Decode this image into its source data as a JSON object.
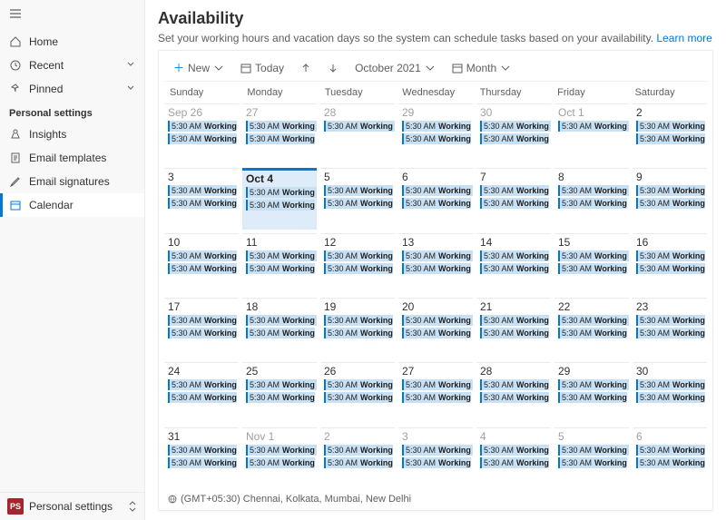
{
  "sidebar": {
    "top": [
      {
        "icon": "home",
        "label": "Home",
        "chev": false
      },
      {
        "icon": "clock",
        "label": "Recent",
        "chev": true
      },
      {
        "icon": "pin",
        "label": "Pinned",
        "chev": true
      }
    ],
    "section_label": "Personal settings",
    "personal": [
      {
        "icon": "insights",
        "label": "Insights",
        "selected": false
      },
      {
        "icon": "doc",
        "label": "Email templates",
        "selected": false
      },
      {
        "icon": "sig",
        "label": "Email signatures",
        "selected": false
      },
      {
        "icon": "cal",
        "label": "Calendar",
        "selected": true
      }
    ],
    "bottom": {
      "badge": "PS",
      "label": "Personal settings"
    }
  },
  "page": {
    "title": "Availability",
    "subtitle": "Set your working hours and vacation days so the system can schedule tasks based on your availability.",
    "learn_more": "Learn more"
  },
  "toolbar": {
    "new": "New",
    "today": "Today",
    "title": "October 2021",
    "view": "Month"
  },
  "day_headers": [
    "Sunday",
    "Monday",
    "Tuesday",
    "Wednesday",
    "Thursday",
    "Friday",
    "Saturday"
  ],
  "event": {
    "time": "5:30 AM",
    "title": "Working"
  },
  "weeks": [
    [
      {
        "d": "Sep 26",
        "ml": true,
        "other": true,
        "ev": 2
      },
      {
        "d": "27",
        "other": true,
        "ev": 2,
        "cont": true
      },
      {
        "d": "28",
        "other": true,
        "ev": 1,
        "cont": true
      },
      {
        "d": "29",
        "other": true,
        "ev": 2
      },
      {
        "d": "30",
        "other": true,
        "ev": 2,
        "cont": true
      },
      {
        "d": "Oct 1",
        "ml": true,
        "ev": 1,
        "cont": true
      },
      {
        "d": "2",
        "ev": 2
      }
    ],
    [
      {
        "d": "3",
        "ev": 2
      },
      {
        "d": "Oct 4",
        "ml": true,
        "today": true,
        "ev": 2,
        "cont": true
      },
      {
        "d": "5",
        "ev": 2
      },
      {
        "d": "6",
        "ev": 2,
        "cont": true
      },
      {
        "d": "7",
        "ev": 2
      },
      {
        "d": "8",
        "ev": 2,
        "cont": true
      },
      {
        "d": "9",
        "ev": 2
      }
    ],
    [
      {
        "d": "10",
        "ev": 2
      },
      {
        "d": "11",
        "ev": 2,
        "cont": true
      },
      {
        "d": "12",
        "ev": 2
      },
      {
        "d": "13",
        "ev": 2,
        "cont": true
      },
      {
        "d": "14",
        "ev": 2
      },
      {
        "d": "15",
        "ev": 2,
        "cont": true
      },
      {
        "d": "16",
        "ev": 2
      }
    ],
    [
      {
        "d": "17",
        "ev": 2
      },
      {
        "d": "18",
        "ev": 2,
        "cont": true
      },
      {
        "d": "19",
        "ev": 2
      },
      {
        "d": "20",
        "ev": 2,
        "cont": true
      },
      {
        "d": "21",
        "ev": 2
      },
      {
        "d": "22",
        "ev": 2,
        "cont": true
      },
      {
        "d": "23",
        "ev": 2
      }
    ],
    [
      {
        "d": "24",
        "ev": 2
      },
      {
        "d": "25",
        "ev": 2,
        "cont": true
      },
      {
        "d": "26",
        "ev": 2
      },
      {
        "d": "27",
        "ev": 2,
        "cont": true
      },
      {
        "d": "28",
        "ev": 2
      },
      {
        "d": "29",
        "ev": 2,
        "cont": true
      },
      {
        "d": "30",
        "ev": 2
      }
    ],
    [
      {
        "d": "31",
        "ev": 2
      },
      {
        "d": "Nov 1",
        "ml": true,
        "other": true,
        "ev": 2,
        "cont": true
      },
      {
        "d": "2",
        "other": true,
        "ev": 2
      },
      {
        "d": "3",
        "other": true,
        "ev": 2,
        "cont": true
      },
      {
        "d": "4",
        "other": true,
        "ev": 2
      },
      {
        "d": "5",
        "other": true,
        "ev": 2,
        "cont": true
      },
      {
        "d": "6",
        "other": true,
        "ev": 2
      }
    ]
  ],
  "timezone": "(GMT+05:30) Chennai, Kolkata, Mumbai, New Delhi"
}
